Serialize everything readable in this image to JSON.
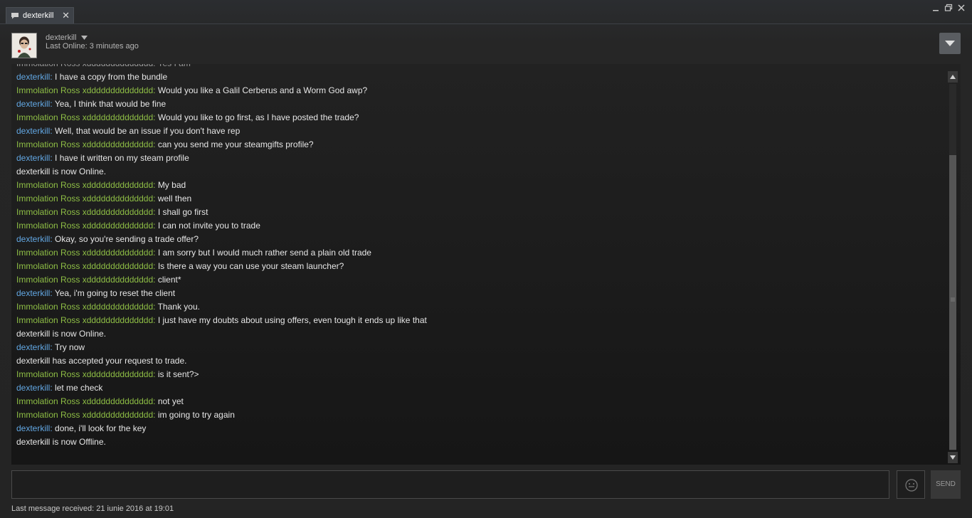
{
  "tab": {
    "label": "dexterkill",
    "close_glyph": "✕"
  },
  "window_controls": {
    "minimize": "–",
    "maximize": "❐",
    "close": "✕"
  },
  "header": {
    "friend_name": "dexterkill",
    "status": "Last Online: 3 minutes ago"
  },
  "colors": {
    "friend_name": "#62a7e3",
    "self_name": "#8ebe45",
    "message_text": "#e6e6e6"
  },
  "chat": {
    "partial_top_line": "Immolation Ross xdddddddddddddd: Yes I am",
    "messages": [
      {
        "type": "friend",
        "sender": "dexterkill",
        "text": "I have a copy from the bundle"
      },
      {
        "type": "self",
        "sender": "Immolation Ross xdddddddddddddd",
        "text": "Would you like a Galil Cerberus and a Worm God awp?"
      },
      {
        "type": "friend",
        "sender": "dexterkill",
        "text": "Yea, I think that would be fine"
      },
      {
        "type": "self",
        "sender": "Immolation Ross xdddddddddddddd",
        "text": "Would you like to go first, as I have posted the trade?"
      },
      {
        "type": "friend",
        "sender": "dexterkill",
        "text": "Well, that would be an issue if you don't have rep"
      },
      {
        "type": "self",
        "sender": "Immolation Ross xdddddddddddddd",
        "text": "can you send me your steamgifts profile?"
      },
      {
        "type": "friend",
        "sender": "dexterkill",
        "text": "I have it written on my steam profile"
      },
      {
        "type": "system",
        "text": "dexterkill is now Online."
      },
      {
        "type": "self",
        "sender": "Immolation Ross xdddddddddddddd",
        "text": "My bad"
      },
      {
        "type": "self",
        "sender": "Immolation Ross xdddddddddddddd",
        "text": "well then"
      },
      {
        "type": "self",
        "sender": "Immolation Ross xdddddddddddddd",
        "text": "I shall go first"
      },
      {
        "type": "self",
        "sender": "Immolation Ross xdddddddddddddd",
        "text": "I can not invite you to trade"
      },
      {
        "type": "friend",
        "sender": "dexterkill",
        "text": "Okay, so you're sending a trade offer?"
      },
      {
        "type": "self",
        "sender": "Immolation Ross xdddddddddddddd",
        "text": "I am sorry but I would much rather send a plain old trade"
      },
      {
        "type": "self",
        "sender": "Immolation Ross xdddddddddddddd",
        "text": "Is there a way you can use your steam launcher?"
      },
      {
        "type": "self",
        "sender": "Immolation Ross xdddddddddddddd",
        "text": "client*"
      },
      {
        "type": "friend",
        "sender": "dexterkill",
        "text": "Yea, i'm going to reset the client"
      },
      {
        "type": "self",
        "sender": "Immolation Ross xdddddddddddddd",
        "text": "Thank you."
      },
      {
        "type": "self",
        "sender": "Immolation Ross xdddddddddddddd",
        "text": "I just have my doubts about using offers, even tough it ends up like that"
      },
      {
        "type": "system",
        "text": "dexterkill is now Online."
      },
      {
        "type": "friend",
        "sender": "dexterkill",
        "text": "Try now"
      },
      {
        "type": "system",
        "text": "dexterkill has accepted your request to trade."
      },
      {
        "type": "self",
        "sender": "Immolation Ross xdddddddddddddd",
        "text": "is it sent?>"
      },
      {
        "type": "friend",
        "sender": "dexterkill",
        "text": "let me check"
      },
      {
        "type": "self",
        "sender": "Immolation Ross xdddddddddddddd",
        "text": "not yet"
      },
      {
        "type": "self",
        "sender": "Immolation Ross xdddddddddddddd",
        "text": "im going to try again"
      },
      {
        "type": "friend",
        "sender": "dexterkill",
        "text": "done, i'll look for the key"
      },
      {
        "type": "system",
        "text": "dexterkill is now Offline."
      }
    ]
  },
  "input": {
    "value": "",
    "placeholder": ""
  },
  "send_button": {
    "label": "SEND"
  },
  "footer": {
    "status": "Last message received: 21 iunie 2016 at 19:01"
  }
}
